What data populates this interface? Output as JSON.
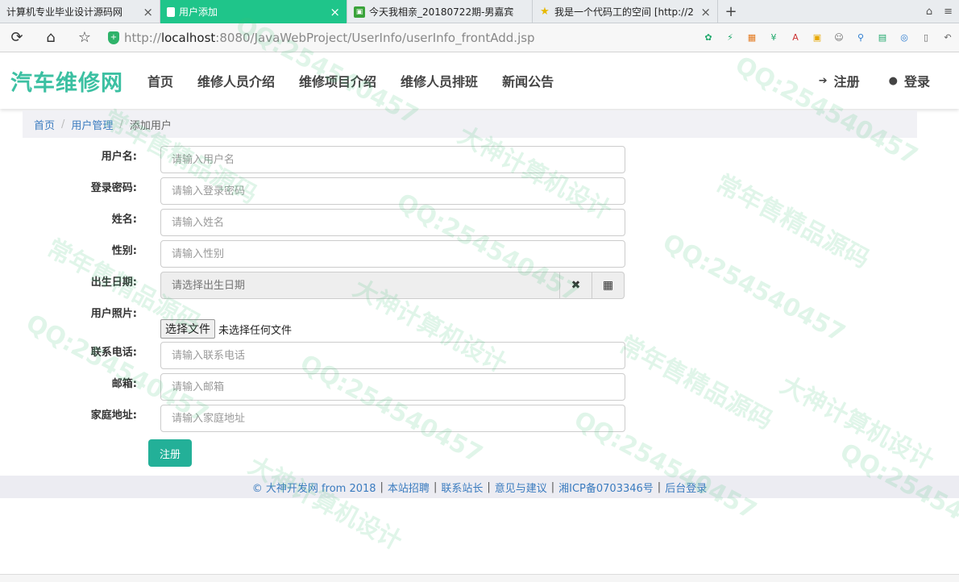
{
  "browser": {
    "tabs": [
      {
        "title": "计算机专业毕业设计源码网",
        "active": false
      },
      {
        "title": "用户添加",
        "active": true
      },
      {
        "title": "今天我相亲_20180722期-男嘉宾",
        "active": false
      },
      {
        "title": "我是一个代码工的空间 [http://2",
        "active": false
      }
    ],
    "new_tab_label": "+",
    "url_scheme": "http://",
    "url_host": "localhost",
    "url_path": ":8080/JavaWebProject/UserInfo/userInfo_frontAdd.jsp"
  },
  "site": {
    "brand": "汽车维修网",
    "nav": [
      "首页",
      "维修人员介绍",
      "维修项目介绍",
      "维修人员排班",
      "新闻公告"
    ],
    "register_label": "注册",
    "login_label": "登录",
    "accent_color": "#3cc0a2"
  },
  "breadcrumb": {
    "home": "首页",
    "section": "用户管理",
    "current": "添加用户"
  },
  "form": {
    "username": {
      "label": "用户名:",
      "placeholder": "请输入用户名"
    },
    "password": {
      "label": "登录密码:",
      "placeholder": "请输入登录密码"
    },
    "name": {
      "label": "姓名:",
      "placeholder": "请输入姓名"
    },
    "gender": {
      "label": "性别:",
      "placeholder": "请输入性别"
    },
    "birthday": {
      "label": "出生日期:",
      "placeholder": "请选择出生日期"
    },
    "photo": {
      "label": "用户照片:",
      "button": "选择文件",
      "status": "未选择任何文件"
    },
    "phone": {
      "label": "联系电话:",
      "placeholder": "请输入联系电话"
    },
    "email": {
      "label": "邮箱:",
      "placeholder": "请输入邮箱"
    },
    "address": {
      "label": "家庭地址:",
      "placeholder": "请输入家庭地址"
    },
    "submit_label": "注册"
  },
  "footer": {
    "copyright": "© 大神开发网 from 2018",
    "links": [
      "本站招聘",
      "联系站长",
      "意见与建议",
      "湘ICP备0703346号",
      "后台登录"
    ]
  },
  "watermarks": [
    "QQ:254540457",
    "常年售精品源码",
    "大神计算机设计"
  ]
}
